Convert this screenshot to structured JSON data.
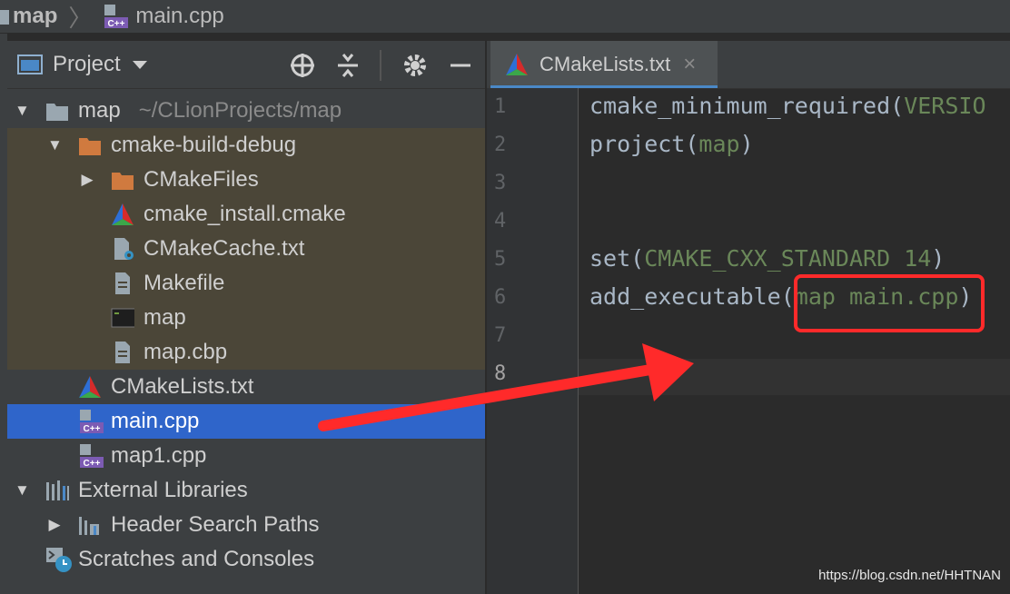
{
  "breadcrumb": {
    "project": "map",
    "file": "main.cpp"
  },
  "project_panel": {
    "title": "Project",
    "tree": [
      {
        "label": "map",
        "detail": "~/CLionProjects/map"
      },
      {
        "label": "cmake-build-debug"
      },
      {
        "label": "CMakeFiles"
      },
      {
        "label": "cmake_install.cmake"
      },
      {
        "label": "CMakeCache.txt"
      },
      {
        "label": "Makefile"
      },
      {
        "label": "map"
      },
      {
        "label": "map.cbp"
      },
      {
        "label": "CMakeLists.txt"
      },
      {
        "label": "main.cpp"
      },
      {
        "label": "map1.cpp"
      },
      {
        "label": "External Libraries"
      },
      {
        "label": "Header Search Paths"
      },
      {
        "label": "Scratches and Consoles"
      }
    ]
  },
  "editor": {
    "tab": {
      "label": "CMakeLists.txt",
      "close": "×"
    },
    "line_numbers": [
      "1",
      "2",
      "3",
      "4",
      "5",
      "6",
      "7",
      "8"
    ],
    "lines": [
      {
        "fn": "cmake_minimum_required",
        "open": "(",
        "arg": "VERSIO",
        "close": ""
      },
      {
        "fn": "project",
        "open": "(",
        "arg": "map",
        "close": ")"
      },
      {
        "fn": "",
        "open": "",
        "arg": "",
        "close": ""
      },
      {
        "fn": "",
        "open": "",
        "arg": "",
        "close": ""
      },
      {
        "fn": "set",
        "open": "(",
        "arg": "CMAKE_CXX_STANDARD 14",
        "close": ")"
      },
      {
        "fn": "add_executable",
        "open": "(",
        "arg": "map main.cpp",
        "close": ")"
      },
      {
        "fn": "",
        "open": "",
        "arg": "",
        "close": ""
      },
      {
        "fn": "",
        "open": "",
        "arg": "",
        "close": ""
      }
    ]
  },
  "watermark": "https://blog.csdn.net/HHTNAN",
  "colors": {
    "selection": "#2f65ca",
    "excluded": "#4b4638",
    "annotation": "#ff2a2a",
    "string_arg": "#6a8759"
  }
}
